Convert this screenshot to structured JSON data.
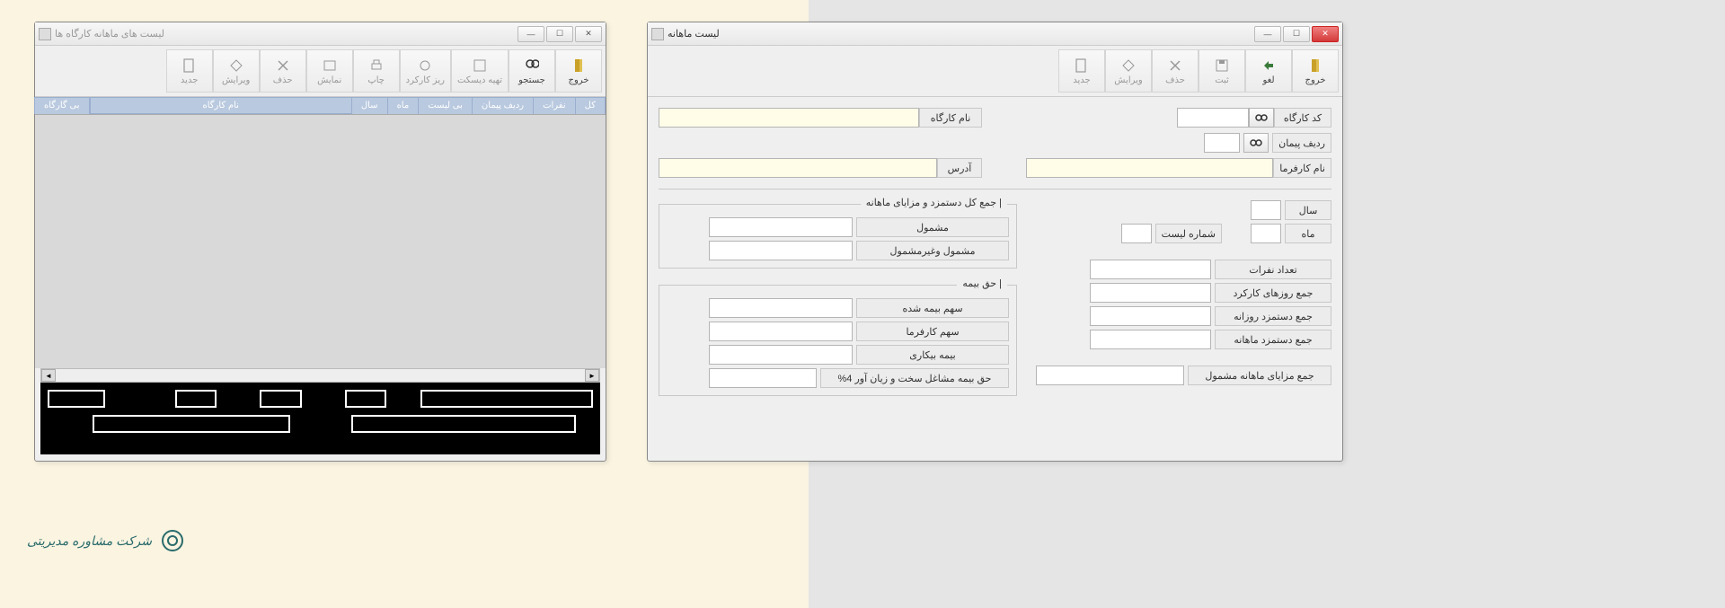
{
  "left_window": {
    "title": "لیست های ماهانه کارگاه ها",
    "toolbar": [
      {
        "label": "جدید",
        "icon": "new"
      },
      {
        "label": "ویرایش",
        "icon": "edit"
      },
      {
        "label": "حذف",
        "icon": "delete"
      },
      {
        "label": "نمایش",
        "icon": "view"
      },
      {
        "label": "چاپ",
        "icon": "print"
      },
      {
        "label": "ریز کارکرد",
        "icon": "detail"
      },
      {
        "label": "تهیه دیسکت",
        "icon": "disk"
      },
      {
        "label": "جستجو",
        "icon": "search"
      },
      {
        "label": "خروج",
        "icon": "exit"
      }
    ],
    "tabs": [
      "بی گارگاه",
      "نام کارگاه",
      "سال",
      "ماه",
      "بی لیست",
      "ردیف پیمان",
      "نفرات",
      "کل"
    ]
  },
  "right_window": {
    "title": "لیست ماهانه",
    "toolbar": [
      {
        "label": "جدید",
        "icon": "new"
      },
      {
        "label": "ویرایش",
        "icon": "edit"
      },
      {
        "label": "حذف",
        "icon": "delete"
      },
      {
        "label": "ثبت",
        "icon": "save"
      },
      {
        "label": "لغو",
        "icon": "cancel"
      },
      {
        "label": "خروج",
        "icon": "exit"
      }
    ],
    "labels": {
      "workshop_code": "کد کارگاه",
      "workshop_name": "نام کارگاه",
      "contract_row": "ردیف پیمان",
      "employer_name": "نام کارفرما",
      "address": "آدرس",
      "year": "سال",
      "month": "ماه",
      "list_no": "شماره لیست",
      "person_count": "تعداد نفرات",
      "work_days_sum": "جمع روزهای کارکرد",
      "daily_wage_sum": "جمع دستمزد روزانه",
      "monthly_wage_sum": "جمع دستمزد ماهانه",
      "monthly_benefits": "جمع مزایای ماهانه مشمول",
      "group_total": "| جمع کل دستمزد و مزایای ماهانه",
      "included": "مشمول",
      "incl_nonincl": "مشمول وغیرمشمول",
      "group_premium": "| حق بیمه",
      "insured_share": "سهم بیمه شده",
      "employer_share": "سهم کارفرما",
      "unemployment": "بیمه بیکاری",
      "hard_job": "حق بیمه مشاغل سخت و زیان آور 4%"
    }
  },
  "logo_text": "شرکت مشاوره مدیریتی"
}
